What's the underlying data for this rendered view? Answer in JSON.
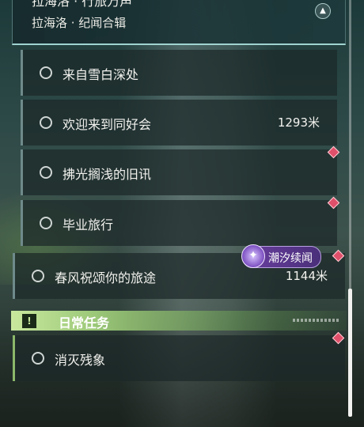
{
  "header": {
    "title": "拉海洛 · 行旅万声",
    "subtitle": "拉海洛 · 纪闻合辑",
    "collapse_icon": "chevron-up-icon"
  },
  "quests": [
    {
      "label": "来自雪白深处",
      "distance": ""
    },
    {
      "label": "欢迎来到同好会",
      "distance": "1293米"
    },
    {
      "label": "拂光搁浅的旧讯",
      "distance": ""
    },
    {
      "label": "毕业旅行",
      "distance": ""
    },
    {
      "label": "春风祝颂你的旅途",
      "distance": "1144米"
    }
  ],
  "tide_badge": {
    "label": "潮汐续闻",
    "icon": "tide-swirl-icon"
  },
  "daily_section": {
    "title": "日常任务",
    "icon": "exclamation-icon"
  },
  "daily_quests": [
    {
      "label": "消灭残象",
      "distance": ""
    }
  ],
  "colors": {
    "accent_teal": "#9fd3d0",
    "marker_red": "#e0506a",
    "daily_green": "#c9e89e",
    "tide_purple": "#6a3fa0"
  }
}
